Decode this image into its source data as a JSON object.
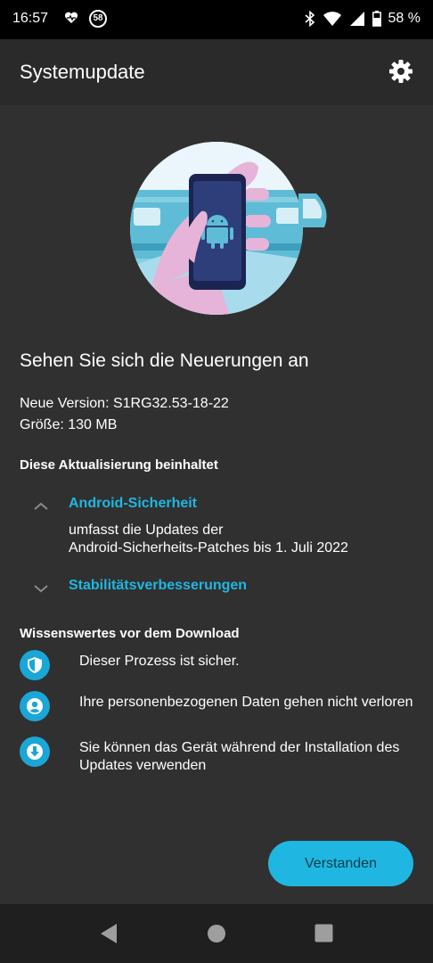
{
  "status_bar": {
    "time": "16:57",
    "badge": "58",
    "battery": "58 %"
  },
  "app_bar": {
    "title": "Systemupdate",
    "settings_icon": "gear-icon"
  },
  "update": {
    "headline": "Sehen Sie sich die Neuerungen an",
    "version": "Neue Version: S1RG32.53-18-22",
    "size": "Größe: 130 MB",
    "contents_title": "Diese Aktualisierung beinhaltet",
    "items": [
      {
        "label": "Android-Sicherheit",
        "expanded": true,
        "description_line1": "umfasst die Updates der",
        "description_line2": "Android-Sicherheits-Patches bis 1. Juli 2022"
      },
      {
        "label": "Stabilitätsverbesserungen",
        "expanded": false
      }
    ]
  },
  "download_info": {
    "title": "Wissenswertes vor dem Download",
    "items": [
      {
        "icon": "shield-icon",
        "text": "Dieser Prozess ist sicher."
      },
      {
        "icon": "person-icon",
        "text": "Ihre personenbezogenen Daten gehen nicht verloren"
      },
      {
        "icon": "download-arrow-icon",
        "text": "Sie können das Gerät während der Installation des Updates verwenden"
      }
    ]
  },
  "actions": {
    "confirm_label": "Verstanden"
  },
  "colors": {
    "accent": "#1fb7e1",
    "background": "#303030",
    "app_bar": "#2a2a2a"
  }
}
